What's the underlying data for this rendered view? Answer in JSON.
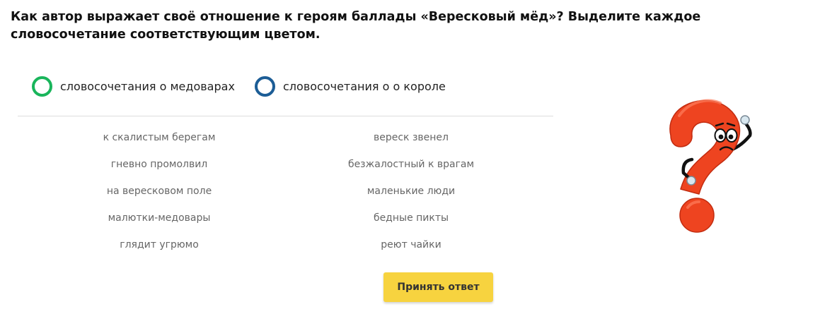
{
  "question": "Как автор выражает своё отношение к героям баллады «Вересковый мёд»? Выделите каждое словосочетание соответствующим цветом.",
  "legend": [
    {
      "label": "словосочетания о медоварах",
      "color": "#19b55b"
    },
    {
      "label": "словосочетания о о короле",
      "color": "#1c5d96"
    }
  ],
  "words": {
    "left": [
      "к скалистым берегам",
      "гневно промолвил",
      "на вересковом поле",
      "малютки-медовары",
      "глядит угрюмо"
    ],
    "right": [
      "вереск звенел",
      "безжалостный к врагам",
      "маленькие люди",
      "бедные пикты",
      "реют чайки"
    ]
  },
  "submit_label": "Принять ответ",
  "mascot_icon": "question-mark-character-icon",
  "colors": {
    "button": "#f7d33f",
    "mascot": "#ee4420"
  }
}
